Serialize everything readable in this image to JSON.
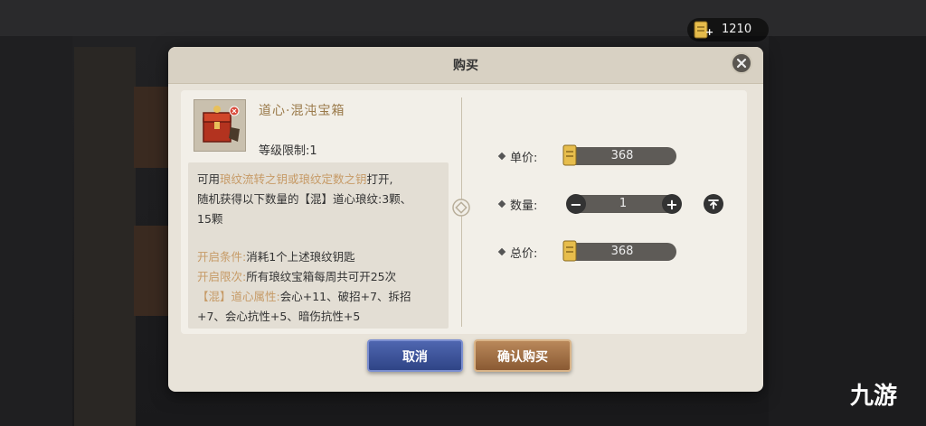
{
  "currency": {
    "amount": "1210",
    "plus": "+",
    "icon": "ticket-icon"
  },
  "dialog": {
    "title": "购买",
    "close_icon": "close-icon",
    "item": {
      "name": "道心·混沌宝箱",
      "level_limit": "等级限制:1",
      "icon": "treasure-chest-icon"
    },
    "description": {
      "line1_a": "可用",
      "line1_b": "琅纹流转之钥或琅纹定数之钥",
      "line1_c": "打开,",
      "line2": "随机获得以下数量的【混】道心琅纹:3颗、",
      "line3": "15颗",
      "condition_label": "开启条件:",
      "condition_value": "消耗1个上述琅纹钥匙",
      "limit_label": "开启限次:",
      "limit_value": "所有琅纹宝箱每周共可开25次",
      "attr_label": "【混】道心属性:",
      "attr_value": "会心+11、破招+7、拆招",
      "attr_line2": "+7、会心抗性+5、暗伤抗性+5"
    },
    "price": {
      "unit_label": "单价:",
      "unit_value": "368",
      "qty_label": "数量:",
      "qty_value": "1",
      "minus": "−",
      "plus": "+",
      "max_icon": "max-icon",
      "total_label": "总价:",
      "total_value": "368"
    },
    "buttons": {
      "cancel": "取消",
      "confirm": "确认购买"
    }
  },
  "watermark": "九游",
  "colors": {
    "highlight": "#c69a66",
    "cancel": "#3a4f99",
    "confirm": "#a06e43"
  }
}
